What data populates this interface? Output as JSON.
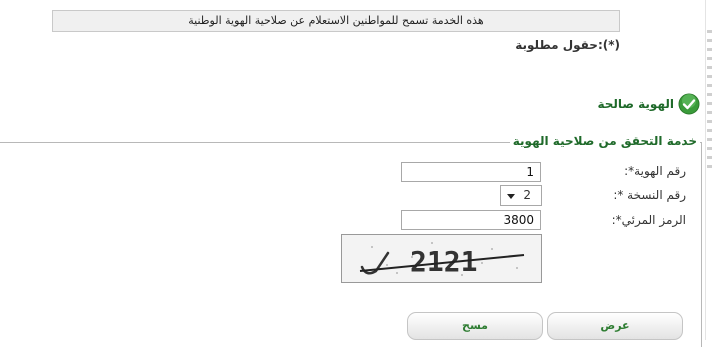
{
  "info_message": "هذه الخدمة تسمح للمواطنين الاستعلام عن صلاحية الهوية الوطنية",
  "required_note": "(*):حقول مطلوبة",
  "status": {
    "text": "الهوية صالحة",
    "icon": "checkmark-icon",
    "color": "#3a9b3a"
  },
  "form": {
    "legend": "خدمة التحقق من صلاحية الهوية",
    "id_label": "رقم الهوية*:",
    "id_value": "1",
    "version_label": "رقم النسخة *:",
    "version_value": "2",
    "captcha_label": "الرمز المرئي*:",
    "captcha_value": "3800",
    "captcha_image_text": "2121"
  },
  "buttons": {
    "view": "عرض",
    "clear": "مسح"
  },
  "colors": {
    "accent_green": "#2e7d32",
    "heading_green": "#1f6a2a"
  }
}
